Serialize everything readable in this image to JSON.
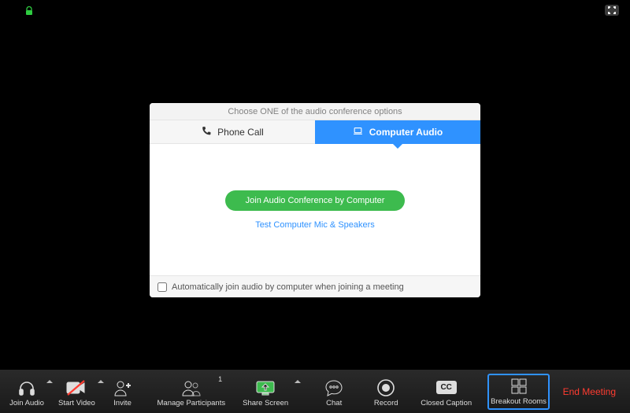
{
  "dialog": {
    "heading": "Choose ONE of the audio conference options",
    "tabs": {
      "phone": "Phone Call",
      "computer": "Computer Audio"
    },
    "join_button": "Join Audio Conference by Computer",
    "test_link": "Test Computer Mic & Speakers",
    "auto_join": "Automatically join audio by computer when joining a meeting",
    "auto_join_checked": false,
    "active_tab": "computer"
  },
  "toolbar": {
    "join_audio": "Join Audio",
    "start_video": "Start Video",
    "invite": "Invite",
    "manage_participants": "Manage Participants",
    "participants_count": "1",
    "share_screen": "Share Screen",
    "chat": "Chat",
    "record": "Record",
    "closed_caption": "Closed Caption",
    "cc_badge": "CC",
    "breakout_rooms": "Breakout Rooms",
    "end_meeting": "End Meeting"
  },
  "colors": {
    "accent_blue": "#2f92ff",
    "accent_green": "#3dbb4e",
    "end_red": "#ff3b30"
  }
}
